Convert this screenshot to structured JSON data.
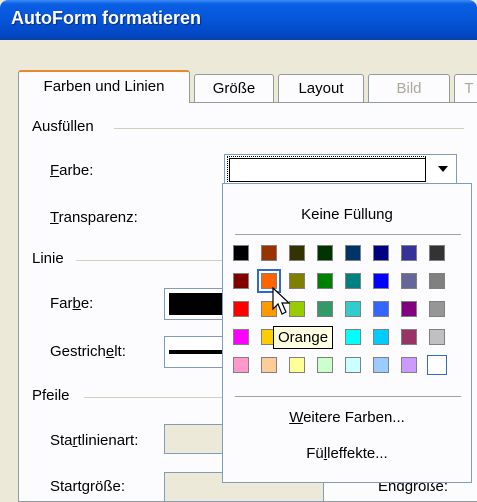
{
  "window": {
    "title": "AutoForm formatieren"
  },
  "tabs": [
    {
      "label": "Farben und Linien",
      "state": "active"
    },
    {
      "label": "Größe",
      "state": "normal"
    },
    {
      "label": "Layout",
      "state": "normal"
    },
    {
      "label": "Bild",
      "state": "disabled"
    },
    {
      "label": "T",
      "state": "disabled"
    }
  ],
  "fill": {
    "group_label": "Ausfüllen",
    "color_label_mnemonic": "F",
    "color_label_rest": "arbe:",
    "transparency_label_mnemonic": "T",
    "transparency_label_rest": "ransparenz:"
  },
  "line": {
    "group_label": "Linie",
    "color_label_pre": "Far",
    "color_label_mnemonic": "b",
    "color_label_rest": "e:",
    "dash_label_pre": "Gestrich",
    "dash_label_mnemonic": "e",
    "dash_label_rest": "lt:"
  },
  "arrows": {
    "group_label": "Pfeile",
    "start_style_pre": "Sta",
    "start_style_mnemonic": "r",
    "start_style_rest": "tlinienart:",
    "start_size_label": "Startgröße:",
    "end_size_label": "Endgröße:"
  },
  "color_popup": {
    "no_fill": "Keine Füllung",
    "more_colors_mnemonic": "W",
    "more_colors_rest": "eitere Farben...",
    "fill_effects_pre": "Fü",
    "fill_effects_mnemonic": "l",
    "fill_effects_rest": "leffekte...",
    "tooltip": "Orange",
    "palette": [
      [
        "#000000",
        "#993300",
        "#333300",
        "#003300",
        "#003366",
        "#000080",
        "#333399",
        "#333333"
      ],
      [
        "#800000",
        "#ff6600",
        "#808000",
        "#008000",
        "#008080",
        "#0000ff",
        "#666699",
        "#808080"
      ],
      [
        "#ff0000",
        "#ff9900",
        "#99cc00",
        "#339966",
        "#33cccc",
        "#3366ff",
        "#800080",
        "#969696"
      ],
      [
        "#ff00ff",
        "#ffcc00",
        "#ffff00",
        "#00ff00",
        "#00ffff",
        "#00ccff",
        "#993366",
        "#c0c0c0"
      ],
      [
        "#ff99cc",
        "#ffcc99",
        "#ffff99",
        "#ccffcc",
        "#ccffff",
        "#99ccff",
        "#cc99ff",
        "#ffffff"
      ]
    ]
  }
}
